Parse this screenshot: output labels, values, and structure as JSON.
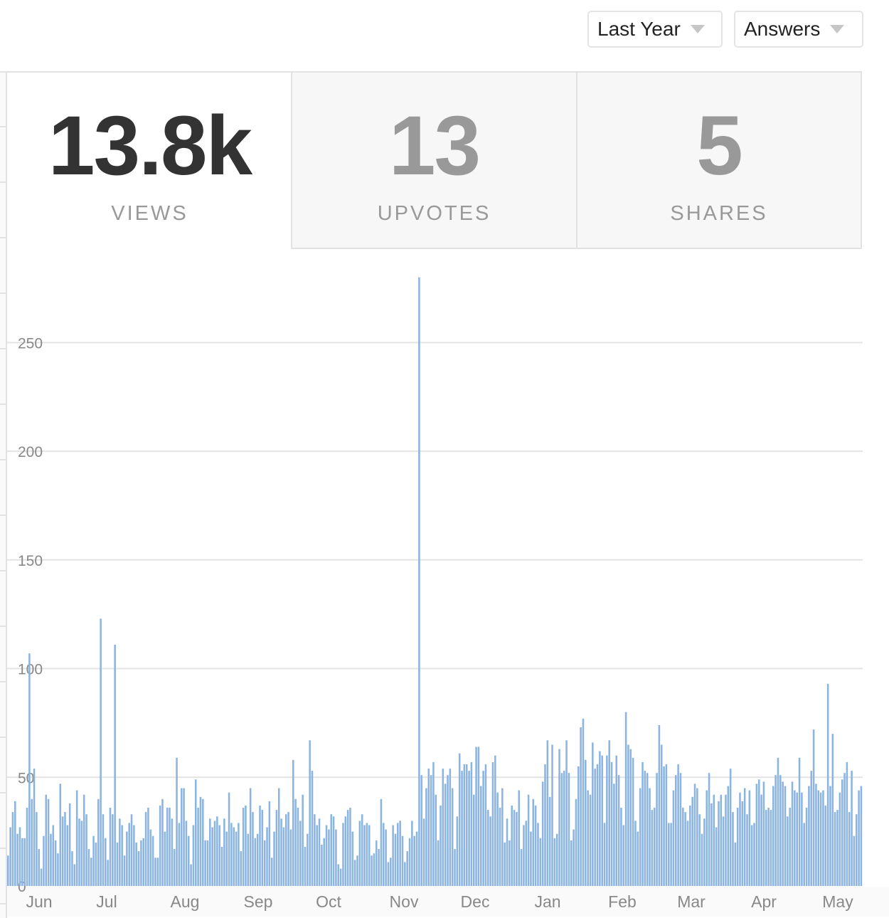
{
  "filters": {
    "period": {
      "selected": "Last Year",
      "icon": "caret-down-icon"
    },
    "content_type": {
      "selected": "Answers",
      "icon": "caret-down-icon"
    }
  },
  "stats": [
    {
      "value": "13.8k",
      "label": "VIEWS",
      "selected": true
    },
    {
      "value": "13",
      "label": "UPVOTES",
      "selected": false
    },
    {
      "value": "5",
      "label": "SHARES",
      "selected": false
    }
  ],
  "chart_data": {
    "type": "bar",
    "title": "",
    "xlabel": "",
    "ylabel": "",
    "bar_color": "#8cb4e0",
    "grid": true,
    "ylim": [
      0,
      293
    ],
    "yticks": [
      0,
      50,
      100,
      150,
      200,
      250
    ],
    "ytick_labels": [
      "0",
      "50",
      "100",
      "150",
      "200",
      "250"
    ],
    "month_labels": [
      "Jun",
      "Jul",
      "Aug",
      "Sep",
      "Oct",
      "Nov",
      "Dec",
      "Jan",
      "Feb",
      "Mar",
      "Apr",
      "May"
    ],
    "values": [
      14,
      27,
      34,
      39,
      24,
      27,
      22,
      22,
      36,
      107,
      40,
      54,
      34,
      17,
      8,
      23,
      42,
      40,
      24,
      28,
      21,
      15,
      47,
      32,
      34,
      28,
      38,
      16,
      10,
      44,
      31,
      30,
      42,
      33,
      17,
      13,
      23,
      20,
      40,
      123,
      33,
      22,
      12,
      36,
      33,
      111,
      20,
      31,
      28,
      14,
      25,
      29,
      33,
      28,
      20,
      16,
      21,
      22,
      34,
      36,
      26,
      23,
      13,
      13,
      37,
      40,
      25,
      36,
      36,
      31,
      17,
      59,
      29,
      45,
      45,
      30,
      23,
      10,
      28,
      49,
      36,
      41,
      40,
      21,
      21,
      31,
      27,
      30,
      32,
      28,
      18,
      31,
      25,
      43,
      29,
      27,
      25,
      29,
      16,
      36,
      37,
      24,
      45,
      34,
      22,
      24,
      37,
      35,
      21,
      27,
      39,
      13,
      25,
      35,
      45,
      31,
      27,
      33,
      34,
      26,
      58,
      40,
      36,
      30,
      42,
      18,
      24,
      67,
      53,
      33,
      28,
      31,
      19,
      22,
      28,
      26,
      33,
      32,
      26,
      10,
      8,
      29,
      32,
      35,
      36,
      25,
      12,
      14,
      30,
      33,
      28,
      29,
      28,
      14,
      15,
      21,
      17,
      40,
      29,
      26,
      11,
      13,
      28,
      24,
      29,
      30,
      23,
      11,
      16,
      22,
      30,
      23,
      25,
      280,
      51,
      31,
      45,
      54,
      51,
      57,
      42,
      21,
      37,
      54,
      47,
      51,
      54,
      45,
      17,
      32,
      61,
      53,
      56,
      56,
      53,
      57,
      42,
      64,
      64,
      46,
      53,
      56,
      35,
      32,
      57,
      60,
      43,
      36,
      45,
      20,
      31,
      21,
      37,
      35,
      34,
      44,
      17,
      28,
      30,
      42,
      25,
      40,
      37,
      29,
      22,
      48,
      56,
      67,
      41,
      65,
      22,
      24,
      63,
      52,
      53,
      67,
      52,
      21,
      26,
      40,
      55,
      73,
      77,
      58,
      44,
      42,
      66,
      54,
      56,
      62,
      60,
      29,
      60,
      67,
      57,
      47,
      60,
      51,
      36,
      28,
      80,
      65,
      63,
      59,
      30,
      25,
      45,
      57,
      53,
      52,
      45,
      35,
      36,
      52,
      74,
      65,
      55,
      56,
      29,
      29,
      44,
      51,
      56,
      52,
      36,
      34,
      30,
      37,
      41,
      47,
      45,
      33,
      24,
      31,
      44,
      52,
      38,
      42,
      27,
      39,
      42,
      32,
      42,
      46,
      54,
      34,
      20,
      36,
      43,
      39,
      45,
      33,
      44,
      28,
      29,
      47,
      49,
      42,
      48,
      35,
      36,
      35,
      46,
      51,
      59,
      51,
      48,
      46,
      32,
      36,
      48,
      44,
      43,
      59,
      43,
      29,
      36,
      46,
      53,
      72,
      47,
      44,
      43,
      44,
      37,
      93,
      46,
      70,
      34,
      35,
      43,
      49,
      52,
      57,
      34,
      53,
      23,
      33,
      44,
      46
    ]
  }
}
